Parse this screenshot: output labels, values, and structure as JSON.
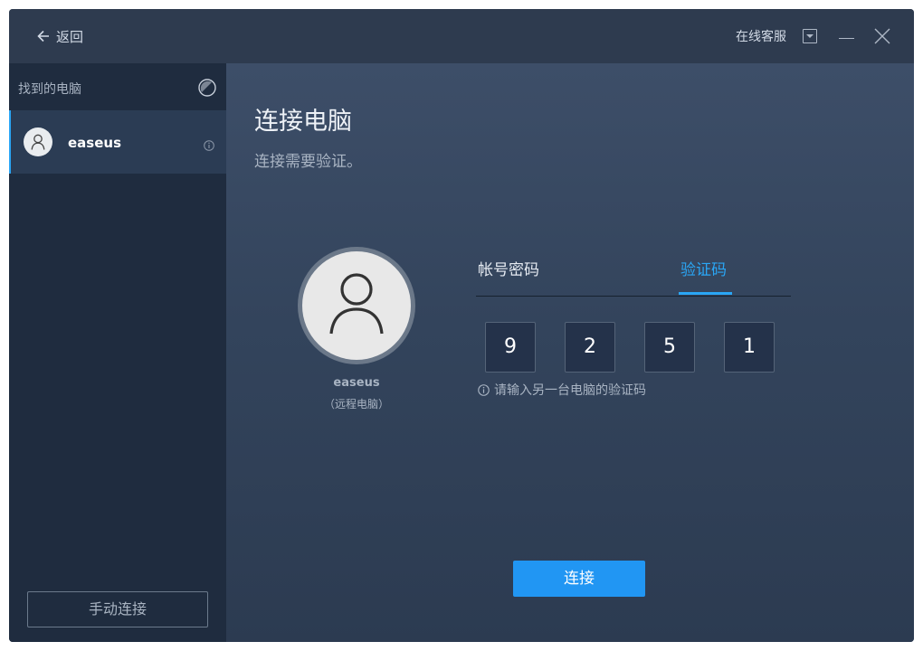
{
  "titlebar": {
    "back_label": "返回",
    "support_label": "在线客服",
    "icons": [
      "arrow-left-icon",
      "dropdown-icon",
      "minimize-icon",
      "close-icon"
    ]
  },
  "sidebar": {
    "header": "找到的电脑",
    "devices": [
      {
        "name": "easeus",
        "selected": true
      }
    ],
    "manual_connect_label": "手动连接"
  },
  "main": {
    "title": "连接电脑",
    "subtitle": "连接需要验证。",
    "remote": {
      "name": "easeus",
      "desc": "（远程电脑）"
    },
    "tabs": [
      {
        "label": "帐号密码",
        "active": false
      },
      {
        "label": "验证码",
        "active": true
      }
    ],
    "code_digits": [
      "9",
      "2",
      "5",
      "1"
    ],
    "hint": "请输入另一台电脑的验证码",
    "connect_label": "连接"
  },
  "colors": {
    "accent": "#2aa6f5",
    "button": "#2196f3",
    "sidebar_bg": "#1f2c3f",
    "titlebar_bg": "#2e3b4f"
  }
}
